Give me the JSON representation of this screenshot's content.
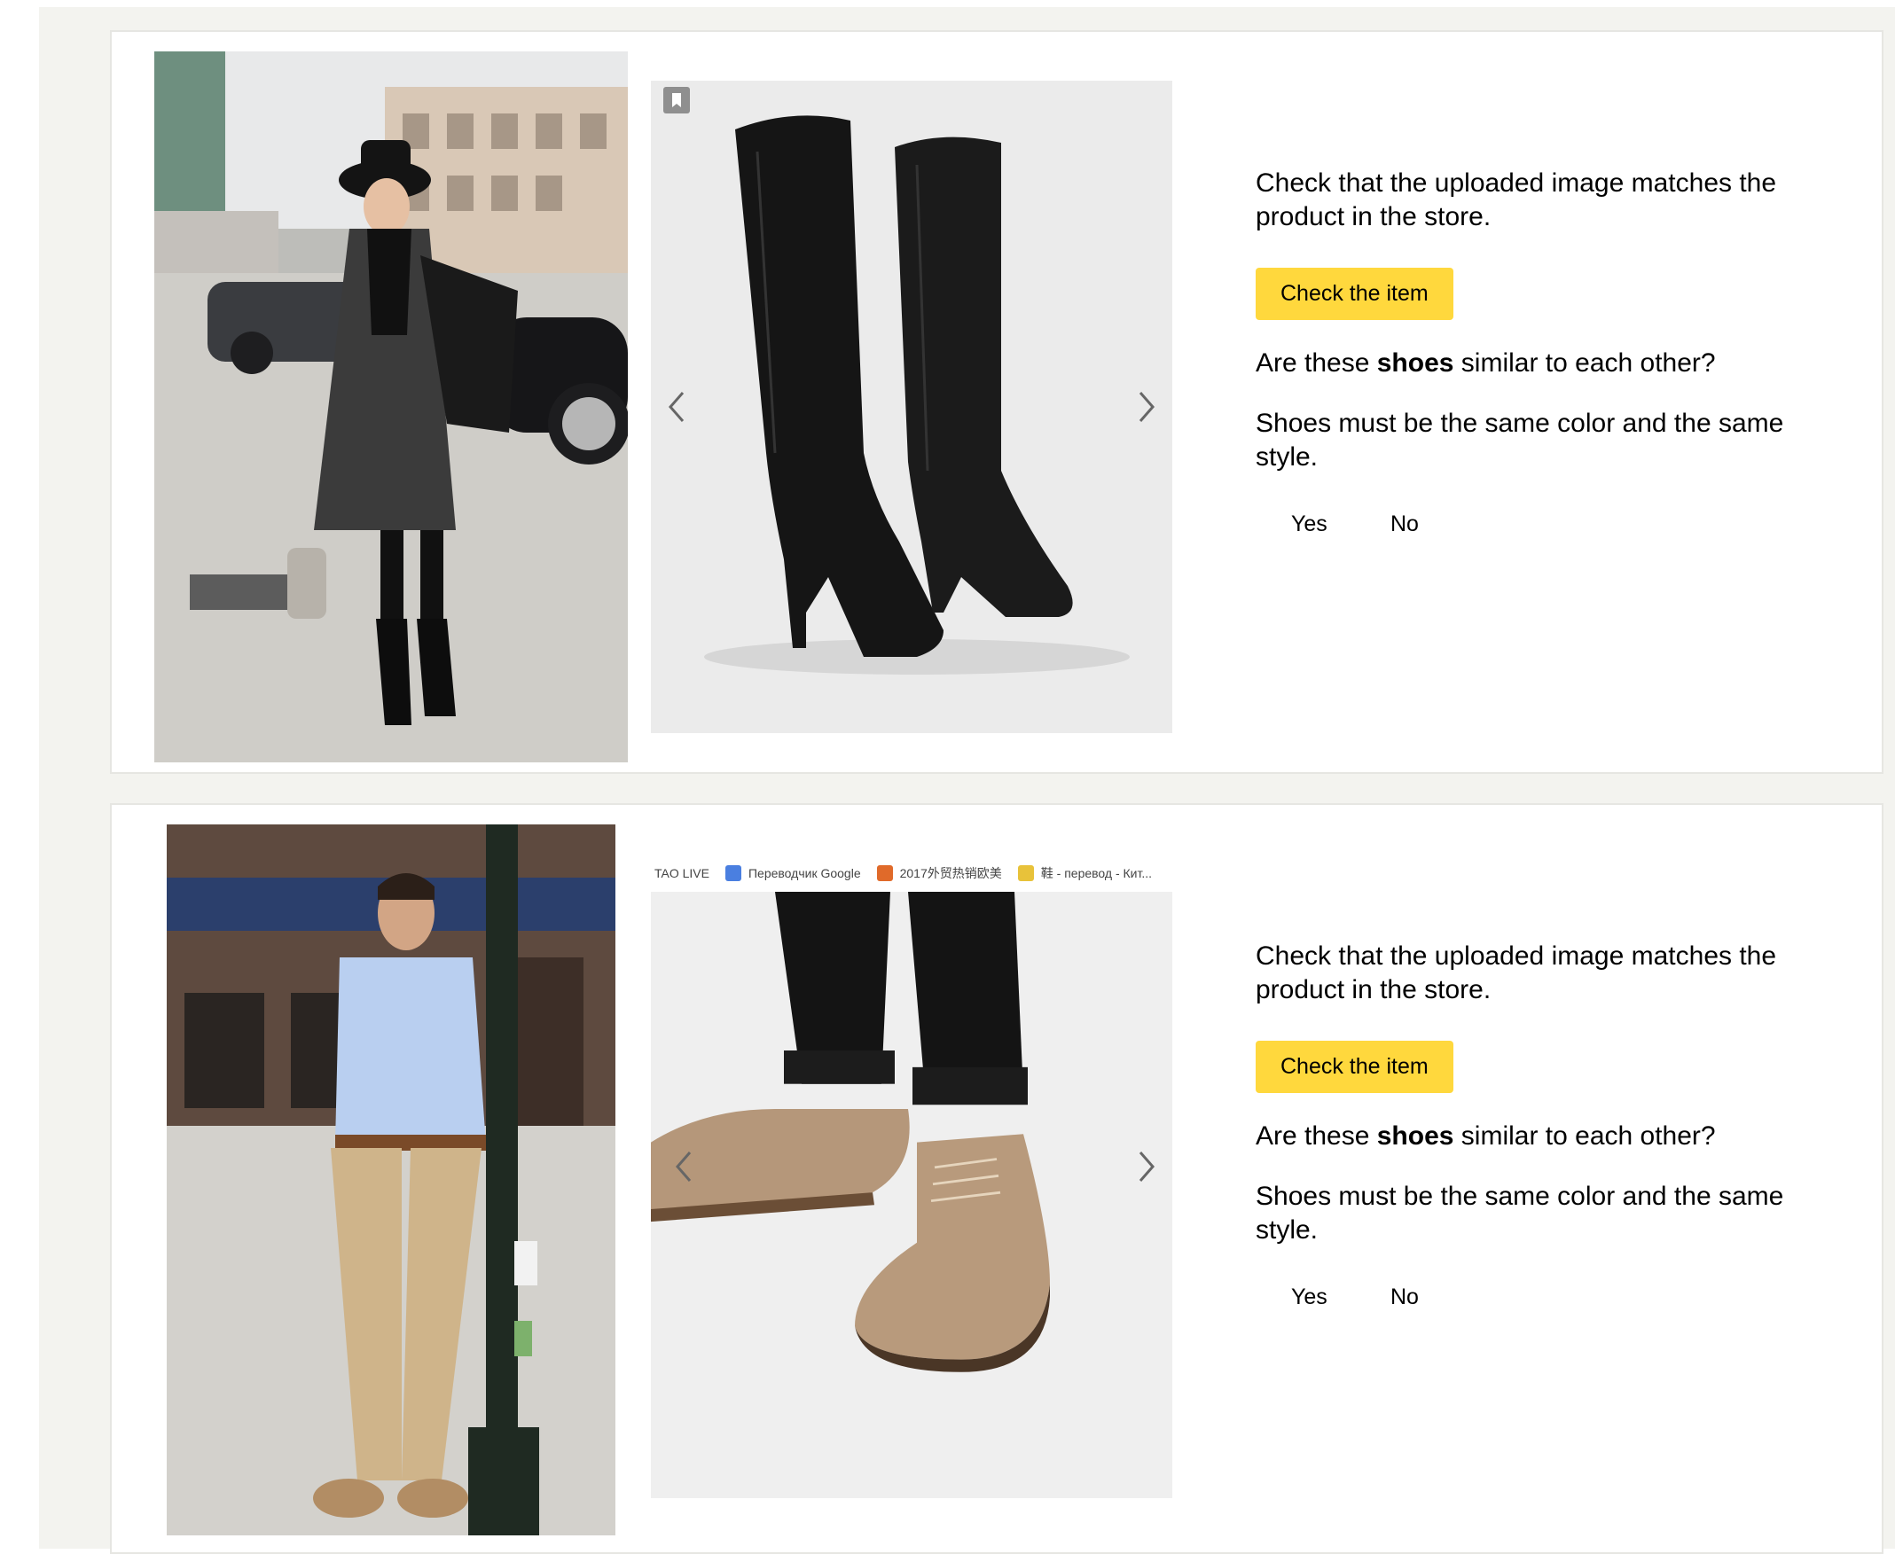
{
  "tasks": [
    {
      "instruction": "Check that the uploaded image matches the product in the store.",
      "check_button_label": "Check the item",
      "question_prefix": "Are these ",
      "question_emphasis": "shoes",
      "question_suffix": " similar to each other?",
      "requirement": "Shoes must be the same color and the same style.",
      "answers": [
        "Yes",
        "No"
      ],
      "icons": {
        "prev": "chevron-left-icon",
        "next": "chevron-right-icon",
        "badge": "bookmark-icon"
      }
    },
    {
      "instruction": "Check that the uploaded image matches the product in the store.",
      "check_button_label": "Check the item",
      "question_prefix": "Are these ",
      "question_emphasis": "shoes",
      "question_suffix": " similar to each other?",
      "requirement": "Shoes must be the same color and the same style.",
      "answers": [
        "Yes",
        "No"
      ],
      "toolbar": [
        "TAO LIVE",
        "Переводчик Google",
        "2017外贸热销欧美",
        "鞋 - перевод - Кит..."
      ],
      "icons": {
        "prev": "chevron-left-icon",
        "next": "chevron-right-icon"
      }
    }
  ],
  "colors": {
    "button": "#ffd83d",
    "page_background": "#f3f3ef",
    "card_border": "#e6e6e2"
  }
}
